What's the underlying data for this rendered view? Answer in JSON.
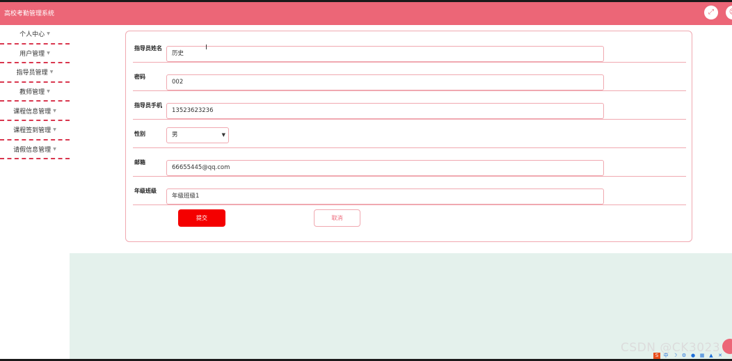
{
  "app": {
    "title": "高校考勤管理系统"
  },
  "header": {
    "fullscreen_icon": "fullscreen-icon",
    "user_icon": "user-icon"
  },
  "sidebar": {
    "items": [
      {
        "label": "个人中心"
      },
      {
        "label": "用户管理"
      },
      {
        "label": "指导员管理"
      },
      {
        "label": "教师管理"
      },
      {
        "label": "课程信息管理"
      },
      {
        "label": "课程签到管理"
      },
      {
        "label": "请假信息管理"
      }
    ]
  },
  "form": {
    "fields": [
      {
        "label": "指导员姓名",
        "value": "历史"
      },
      {
        "label": "密码",
        "value": "002"
      },
      {
        "label": "指导员手机",
        "value": "13523623236"
      },
      {
        "label": "性别",
        "value": "男"
      },
      {
        "label": "邮箱",
        "value": "66655445@qq.com"
      },
      {
        "label": "年级班级",
        "value": "年级班级1"
      }
    ],
    "submit_label": "提交",
    "cancel_label": "取消"
  },
  "watermark": "CSDN @CK3023",
  "colors": {
    "header": "#ec6677",
    "submit": "#f40000",
    "border": "#f0a8b0",
    "background_lower": "#e4f1ec"
  }
}
